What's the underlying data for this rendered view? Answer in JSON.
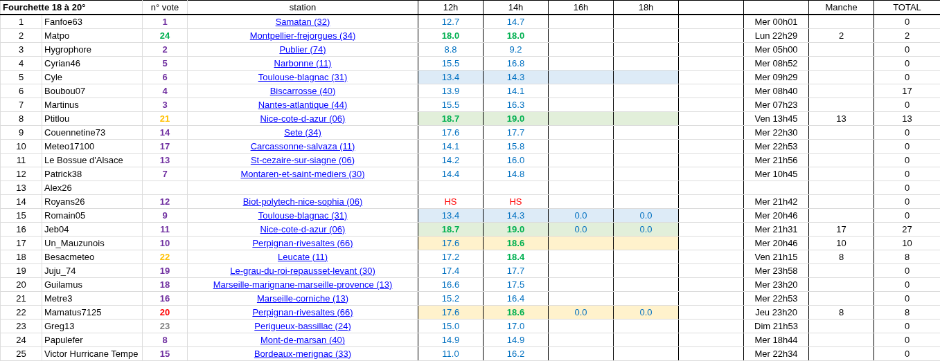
{
  "header": {
    "title": "Fourchette 18 à 20°",
    "vote": "n° vote",
    "station": "station",
    "hours": [
      "12h",
      "14h",
      "16h",
      "18h"
    ],
    "manche": "Manche",
    "total": "TOTAL"
  },
  "rows": [
    {
      "rank": "1",
      "name": "Fanfoe63",
      "vote": {
        "text": "1",
        "color": "#7030a0"
      },
      "station": "Samatan (32)",
      "temps": [
        {
          "text": "12.7",
          "kind": "normal"
        },
        {
          "text": "14.7",
          "kind": "normal"
        }
      ],
      "date": "Mer 00h01",
      "total": "0"
    },
    {
      "rank": "2",
      "name": "Matpo",
      "vote": {
        "text": "24",
        "color": "#00b050"
      },
      "station": "Montpellier-frejorgues (34)",
      "temps": [
        {
          "text": "18.0",
          "kind": "hit"
        },
        {
          "text": "18.0",
          "kind": "hit"
        }
      ],
      "date": "Lun 22h29",
      "manche": "2",
      "total": "2"
    },
    {
      "rank": "3",
      "name": "Hygrophore",
      "vote": {
        "text": "2",
        "color": "#7030a0"
      },
      "station": "Publier (74)",
      "temps": [
        {
          "text": "8.8",
          "kind": "normal"
        },
        {
          "text": "9.2",
          "kind": "normal"
        }
      ],
      "date": "Mer 05h00",
      "total": "0"
    },
    {
      "rank": "4",
      "name": "Cyrian46",
      "vote": {
        "text": "5",
        "color": "#7030a0"
      },
      "station": "Narbonne (11)",
      "temps": [
        {
          "text": "15.5",
          "kind": "normal"
        },
        {
          "text": "16.8",
          "kind": "normal"
        }
      ],
      "date": "Mer 08h52",
      "total": "0"
    },
    {
      "rank": "5",
      "name": "Cyle",
      "vote": {
        "text": "6",
        "color": "#7030a0"
      },
      "station": "Toulouse-blagnac (31)",
      "temps": [
        {
          "text": "13.4",
          "kind": "normal"
        },
        {
          "text": "14.3",
          "kind": "normal"
        }
      ],
      "date": "Mer 09h29",
      "total": "0",
      "highlight": {
        "color": "#ddebf7"
      }
    },
    {
      "rank": "6",
      "name": "Boubou07",
      "vote": {
        "text": "4",
        "color": "#7030a0"
      },
      "station": "Biscarrosse (40)",
      "temps": [
        {
          "text": "13.9",
          "kind": "normal"
        },
        {
          "text": "14.1",
          "kind": "normal"
        }
      ],
      "date": "Mer 08h40",
      "total": "17"
    },
    {
      "rank": "7",
      "name": "Martinus",
      "vote": {
        "text": "3",
        "color": "#7030a0"
      },
      "station": "Nantes-atlantique (44)",
      "temps": [
        {
          "text": "15.5",
          "kind": "normal"
        },
        {
          "text": "16.3",
          "kind": "normal"
        }
      ],
      "date": "Mer 07h23",
      "total": "0"
    },
    {
      "rank": "8",
      "name": "Ptitlou",
      "vote": {
        "text": "21",
        "color": "#ffc000"
      },
      "station": "Nice-cote-d-azur (06)",
      "temps": [
        {
          "text": "18.7",
          "kind": "hit"
        },
        {
          "text": "19.0",
          "kind": "hit"
        }
      ],
      "date": "Ven 13h45",
      "manche": "13",
      "total": "13",
      "highlight": {
        "color": "#e2efda"
      }
    },
    {
      "rank": "9",
      "name": "Couennetine73",
      "vote": {
        "text": "14",
        "color": "#7030a0"
      },
      "station": "Sete (34)",
      "temps": [
        {
          "text": "17.6",
          "kind": "normal"
        },
        {
          "text": "17.7",
          "kind": "normal"
        }
      ],
      "date": "Mer 22h30",
      "total": "0"
    },
    {
      "rank": "10",
      "name": "Meteo17100",
      "vote": {
        "text": "17",
        "color": "#7030a0"
      },
      "station": "Carcassonne-salvaza (11)",
      "temps": [
        {
          "text": "14.1",
          "kind": "normal"
        },
        {
          "text": "15.8",
          "kind": "normal"
        }
      ],
      "date": "Mer 22h53",
      "total": "0"
    },
    {
      "rank": "11",
      "name": "Le Bossue d'Alsace",
      "vote": {
        "text": "13",
        "color": "#7030a0"
      },
      "station": "St-cezaire-sur-siagne (06)",
      "temps": [
        {
          "text": "14.2",
          "kind": "normal"
        },
        {
          "text": "16.0",
          "kind": "normal"
        }
      ],
      "date": "Mer 21h56",
      "total": "0"
    },
    {
      "rank": "12",
      "name": "Patrick38",
      "vote": {
        "text": "7",
        "color": "#7030a0"
      },
      "station": "Montaren-et-saint-mediers (30)",
      "temps": [
        {
          "text": "14.4",
          "kind": "normal"
        },
        {
          "text": "14.8",
          "kind": "normal"
        }
      ],
      "date": "Mer 10h45",
      "total": "0"
    },
    {
      "rank": "13",
      "name": "Alex26",
      "temps": [],
      "total": "0"
    },
    {
      "rank": "14",
      "name": "Royans26",
      "vote": {
        "text": "12",
        "color": "#7030a0"
      },
      "station": "Biot-polytech-nice-sophia (06)",
      "temps": [
        {
          "text": "HS",
          "kind": "hs"
        },
        {
          "text": "HS",
          "kind": "hs"
        }
      ],
      "date": "Mer 21h42",
      "total": "0"
    },
    {
      "rank": "15",
      "name": "Romain05",
      "vote": {
        "text": "9",
        "color": "#7030a0"
      },
      "station": "Toulouse-blagnac (31)",
      "temps": [
        {
          "text": "13.4",
          "kind": "normal"
        },
        {
          "text": "14.3",
          "kind": "normal"
        },
        {
          "text": "0.0",
          "kind": "normal"
        },
        {
          "text": "0.0",
          "kind": "normal"
        }
      ],
      "date": "Mer 20h46",
      "total": "0",
      "highlight": {
        "color": "#ddebf7"
      }
    },
    {
      "rank": "16",
      "name": "Jeb04",
      "vote": {
        "text": "11",
        "color": "#7030a0"
      },
      "station": "Nice-cote-d-azur (06)",
      "temps": [
        {
          "text": "18.7",
          "kind": "hit"
        },
        {
          "text": "19.0",
          "kind": "hit"
        },
        {
          "text": "0.0",
          "kind": "normal"
        },
        {
          "text": "0.0",
          "kind": "normal"
        }
      ],
      "date": "Mer 21h31",
      "manche": "17",
      "total": "27",
      "highlight": {
        "color": "#e2efda"
      }
    },
    {
      "rank": "17",
      "name": "Un_Mauzunois",
      "vote": {
        "text": "10",
        "color": "#7030a0"
      },
      "station": "Perpignan-rivesaltes (66)",
      "temps": [
        {
          "text": "17.6",
          "kind": "normal"
        },
        {
          "text": "18.6",
          "kind": "hit"
        }
      ],
      "date": "Mer 20h46",
      "manche": "10",
      "total": "10",
      "highlight": {
        "color": "#fff2cc"
      }
    },
    {
      "rank": "18",
      "name": "Besacmeteo",
      "vote": {
        "text": "22",
        "color": "#ffc000"
      },
      "station": "Leucate (11)",
      "temps": [
        {
          "text": "17.2",
          "kind": "normal"
        },
        {
          "text": "18.4",
          "kind": "hit"
        }
      ],
      "date": "Ven 21h15",
      "manche": "8",
      "total": "8"
    },
    {
      "rank": "19",
      "name": "Juju_74",
      "vote": {
        "text": "19",
        "color": "#7030a0"
      },
      "station": "Le-grau-du-roi-repausset-levant (30)",
      "temps": [
        {
          "text": "17.4",
          "kind": "normal"
        },
        {
          "text": "17.7",
          "kind": "normal"
        }
      ],
      "date": "Mer 23h58",
      "total": "0"
    },
    {
      "rank": "20",
      "name": "Guilamus",
      "vote": {
        "text": "18",
        "color": "#7030a0"
      },
      "station": "Marseille-marignane-marseille-provence (13)",
      "temps": [
        {
          "text": "16.6",
          "kind": "normal"
        },
        {
          "text": "17.5",
          "kind": "normal"
        }
      ],
      "date": "Mer 23h20",
      "total": "0"
    },
    {
      "rank": "21",
      "name": "Metre3",
      "vote": {
        "text": "16",
        "color": "#7030a0"
      },
      "station": "Marseille-corniche (13)",
      "temps": [
        {
          "text": "15.2",
          "kind": "normal"
        },
        {
          "text": "16.4",
          "kind": "normal"
        }
      ],
      "date": "Mer 22h53",
      "total": "0"
    },
    {
      "rank": "22",
      "name": "Mamatus7125",
      "vote": {
        "text": "20",
        "color": "#ff0000"
      },
      "station": "Perpignan-rivesaltes (66)",
      "temps": [
        {
          "text": "17.6",
          "kind": "normal"
        },
        {
          "text": "18.6",
          "kind": "hit"
        },
        {
          "text": "0.0",
          "kind": "normal"
        },
        {
          "text": "0.0",
          "kind": "normal"
        }
      ],
      "date": "Jeu 23h20",
      "manche": "8",
      "total": "8",
      "highlight": {
        "color": "#fff2cc"
      }
    },
    {
      "rank": "23",
      "name": "Greg13",
      "vote": {
        "text": "23",
        "color": "#808080"
      },
      "station": "Perigueux-bassillac (24)",
      "temps": [
        {
          "text": "15.0",
          "kind": "normal"
        },
        {
          "text": "17.0",
          "kind": "normal"
        }
      ],
      "date": "Dim 21h53",
      "total": "0"
    },
    {
      "rank": "24",
      "name": "Papulefer",
      "vote": {
        "text": "8",
        "color": "#7030a0"
      },
      "station": "Mont-de-marsan (40)",
      "temps": [
        {
          "text": "14.9",
          "kind": "normal"
        },
        {
          "text": "14.9",
          "kind": "normal"
        }
      ],
      "date": "Mer 18h44",
      "total": "0"
    },
    {
      "rank": "25",
      "name": "Victor Hurricane Tempe",
      "vote": {
        "text": "15",
        "color": "#7030a0"
      },
      "station": "Bordeaux-merignac (33)",
      "temps": [
        {
          "text": "11.0",
          "kind": "normal"
        },
        {
          "text": "16.2",
          "kind": "normal"
        }
      ],
      "date": "Mer 22h34",
      "total": "0"
    }
  ]
}
